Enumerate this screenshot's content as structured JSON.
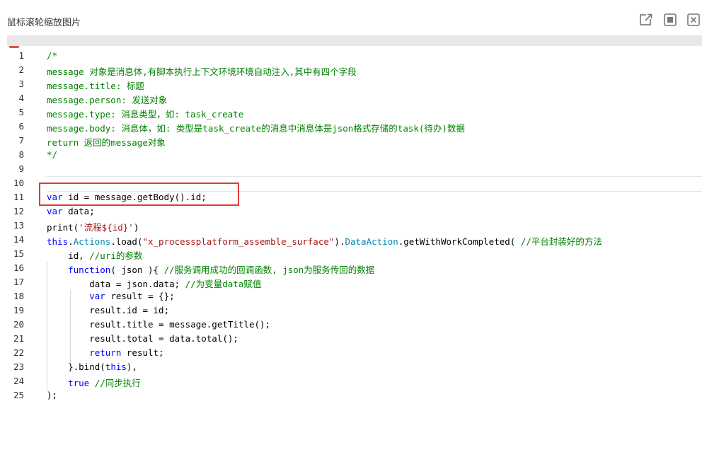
{
  "window": {
    "title": "鼠标滚轮缩放图片",
    "buttons": [
      {
        "icon": "external-link-icon"
      },
      {
        "icon": "maximize-icon"
      },
      {
        "icon": "close-icon"
      }
    ]
  },
  "editor": {
    "lines": [
      {
        "n": "1",
        "segs": [
          {
            "t": "/*",
            "c": "c-com"
          }
        ]
      },
      {
        "n": "2",
        "segs": [
          {
            "t": "message 对象是消息体,有脚本执行上下文环境环境自动注入,其中有四个字段",
            "c": "c-com"
          }
        ]
      },
      {
        "n": "3",
        "segs": [
          {
            "t": "message.title: 标题",
            "c": "c-com"
          }
        ]
      },
      {
        "n": "4",
        "segs": [
          {
            "t": "message.person: 发送对象",
            "c": "c-com"
          }
        ]
      },
      {
        "n": "5",
        "segs": [
          {
            "t": "message.type: 消息类型，如: task_create",
            "c": "c-com"
          }
        ]
      },
      {
        "n": "6",
        "segs": [
          {
            "t": "message.body: 消息体，如: 类型是task_create的消息中消息体是json格式存储的task(待办)数据",
            "c": "c-com"
          }
        ]
      },
      {
        "n": "7",
        "segs": [
          {
            "t": "return 返回的message对象",
            "c": "c-com"
          }
        ]
      },
      {
        "n": "8",
        "segs": [
          {
            "t": "*/",
            "c": "c-com"
          }
        ]
      },
      {
        "n": "9",
        "segs": []
      },
      {
        "n": "10",
        "segs": []
      },
      {
        "n": "11",
        "segs": [
          {
            "t": "var",
            "c": "c-kw"
          },
          {
            "t": " id = message.getBody().id;",
            "c": "c-plain"
          }
        ]
      },
      {
        "n": "12",
        "segs": [
          {
            "t": "var",
            "c": "c-kw"
          },
          {
            "t": " data;",
            "c": "c-plain"
          }
        ]
      },
      {
        "n": "13",
        "segs": [
          {
            "t": "print(",
            "c": "c-plain"
          },
          {
            "t": "'流程${id}'",
            "c": "c-str"
          },
          {
            "t": ")",
            "c": "c-plain"
          }
        ]
      },
      {
        "n": "14",
        "segs": [
          {
            "t": "this",
            "c": "c-kw"
          },
          {
            "t": ".",
            "c": "c-plain"
          },
          {
            "t": "Actions",
            "c": "c-fn"
          },
          {
            "t": ".load(",
            "c": "c-plain"
          },
          {
            "t": "\"x_processplatform_assemble_surface\"",
            "c": "c-str"
          },
          {
            "t": ").",
            "c": "c-plain"
          },
          {
            "t": "DataAction",
            "c": "c-fn"
          },
          {
            "t": ".getWithWorkCompleted( ",
            "c": "c-plain"
          },
          {
            "t": "//平台封装好的方法",
            "c": "c-com"
          }
        ]
      },
      {
        "n": "15",
        "segs": [
          {
            "t": "    id, ",
            "c": "c-plain"
          },
          {
            "t": "//uri的参数",
            "c": "c-com"
          }
        ]
      },
      {
        "n": "16",
        "segs": [
          {
            "t": "    ",
            "c": "c-plain"
          },
          {
            "t": "function",
            "c": "c-kw"
          },
          {
            "t": "( json ){ ",
            "c": "c-plain"
          },
          {
            "t": "//服务调用成功的回调函数, json为服务传回的数据",
            "c": "c-com"
          }
        ]
      },
      {
        "n": "17",
        "segs": [
          {
            "t": "        data = json.data; ",
            "c": "c-plain"
          },
          {
            "t": "//为变量data赋值",
            "c": "c-com"
          }
        ]
      },
      {
        "n": "18",
        "segs": [
          {
            "t": "        ",
            "c": "c-plain"
          },
          {
            "t": "var",
            "c": "c-kw"
          },
          {
            "t": " result = {};",
            "c": "c-plain"
          }
        ]
      },
      {
        "n": "19",
        "segs": [
          {
            "t": "        result.id = id;",
            "c": "c-plain"
          }
        ]
      },
      {
        "n": "20",
        "segs": [
          {
            "t": "        result.title = message.getTitle();",
            "c": "c-plain"
          }
        ]
      },
      {
        "n": "21",
        "segs": [
          {
            "t": "        result.total = data.total();",
            "c": "c-plain"
          }
        ]
      },
      {
        "n": "22",
        "segs": [
          {
            "t": "        ",
            "c": "c-plain"
          },
          {
            "t": "return",
            "c": "c-kw"
          },
          {
            "t": " result;",
            "c": "c-plain"
          }
        ]
      },
      {
        "n": "23",
        "segs": [
          {
            "t": "    }.bind(",
            "c": "c-plain"
          },
          {
            "t": "this",
            "c": "c-kw"
          },
          {
            "t": "),",
            "c": "c-plain"
          }
        ]
      },
      {
        "n": "24",
        "segs": [
          {
            "t": "    ",
            "c": "c-plain"
          },
          {
            "t": "true",
            "c": "c-kw"
          },
          {
            "t": " ",
            "c": "c-plain"
          },
          {
            "t": "//同步执行",
            "c": "c-com"
          }
        ]
      },
      {
        "n": "25",
        "segs": [
          {
            "t": ");",
            "c": "c-plain"
          }
        ]
      }
    ]
  },
  "colors": {
    "comment": "#008000",
    "keyword": "#0000ff",
    "string": "#a31515",
    "type": "#0086b3",
    "highlight_box": "#e03a3a"
  }
}
